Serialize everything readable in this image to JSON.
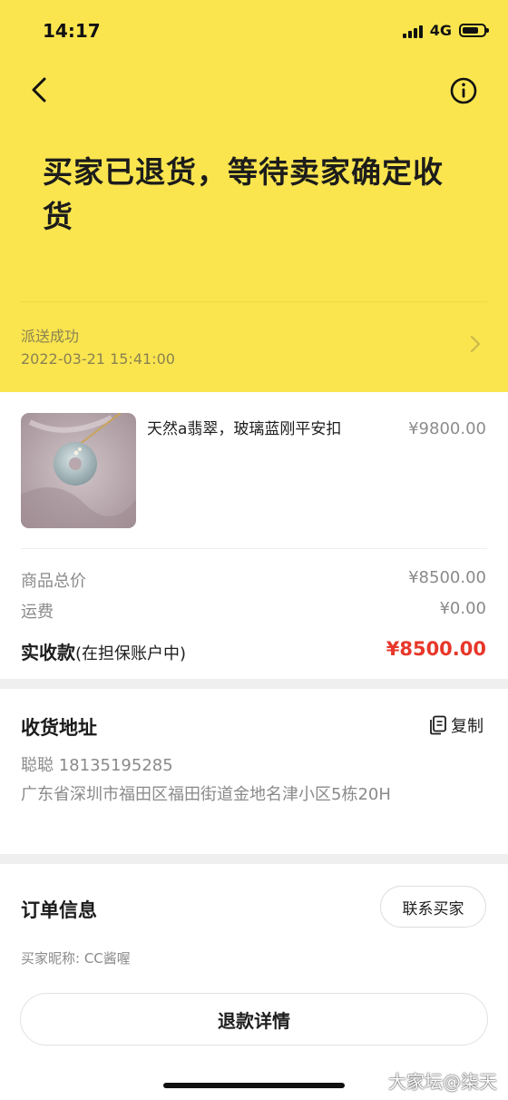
{
  "status_bar": {
    "time": "14:17",
    "network": "4G"
  },
  "header": {
    "title": "买家已退货，等待卖家确定收货",
    "delivery_status": "派送成功",
    "delivery_time": "2022-03-21 15:41:00"
  },
  "product": {
    "name": "天然a翡翠，玻璃蓝刚平安扣",
    "price": "¥9800.00"
  },
  "summary": {
    "total_label": "商品总价",
    "total_value": "¥8500.00",
    "shipping_label": "运费",
    "shipping_value": "¥0.00",
    "actual_label": "实收款",
    "actual_sub": "(在担保账户中)",
    "actual_value": "¥8500.00"
  },
  "address": {
    "title": "收货地址",
    "copy_label": "复制",
    "contact": "聪聪 18135195285",
    "detail": "广东省深圳市福田区福田街道金地名津小区5栋20H"
  },
  "order": {
    "title": "订单信息",
    "contact_button": "联系买家",
    "buyer_nickname": "买家昵称: CC酱喔",
    "refund_button": "退款详情"
  },
  "watermark": "大家坛@柒天",
  "colors": {
    "header_bg": "#fae54f",
    "accent_red": "#e7372a"
  }
}
